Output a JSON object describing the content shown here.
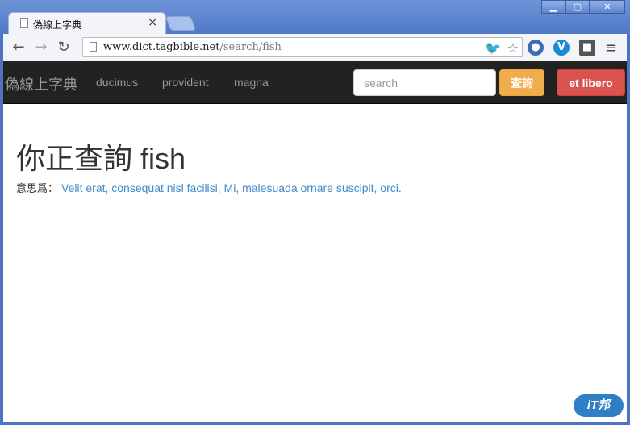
{
  "browser": {
    "tab_title": "偽線上字典",
    "tab_close": "×",
    "window_controls": {
      "minimize": "▁",
      "maximize": "▢",
      "close": "✕"
    },
    "toolbar": {
      "back": "←",
      "forward": "→",
      "reload": "↻",
      "menu": "≡"
    },
    "url_host": "www.dict.tagbible.net",
    "url_path": "/search/fish",
    "extensions": {
      "twitter": "🐦",
      "star": "☆",
      "globe": "●",
      "v": "V",
      "grid": "■"
    }
  },
  "navbar": {
    "brand": "偽線上字典",
    "links": [
      "ducimus",
      "provident",
      "magna"
    ],
    "search_placeholder": "search",
    "search_button": "查詢",
    "action_button": "et libero"
  },
  "main": {
    "heading": "你正查詢 fish",
    "meaning_label": "意思爲：",
    "meaning_text": "Velit erat, consequat nisl facilisi, Mi, malesuada ornare suscipit, orci."
  },
  "watermark": "iT邦"
}
